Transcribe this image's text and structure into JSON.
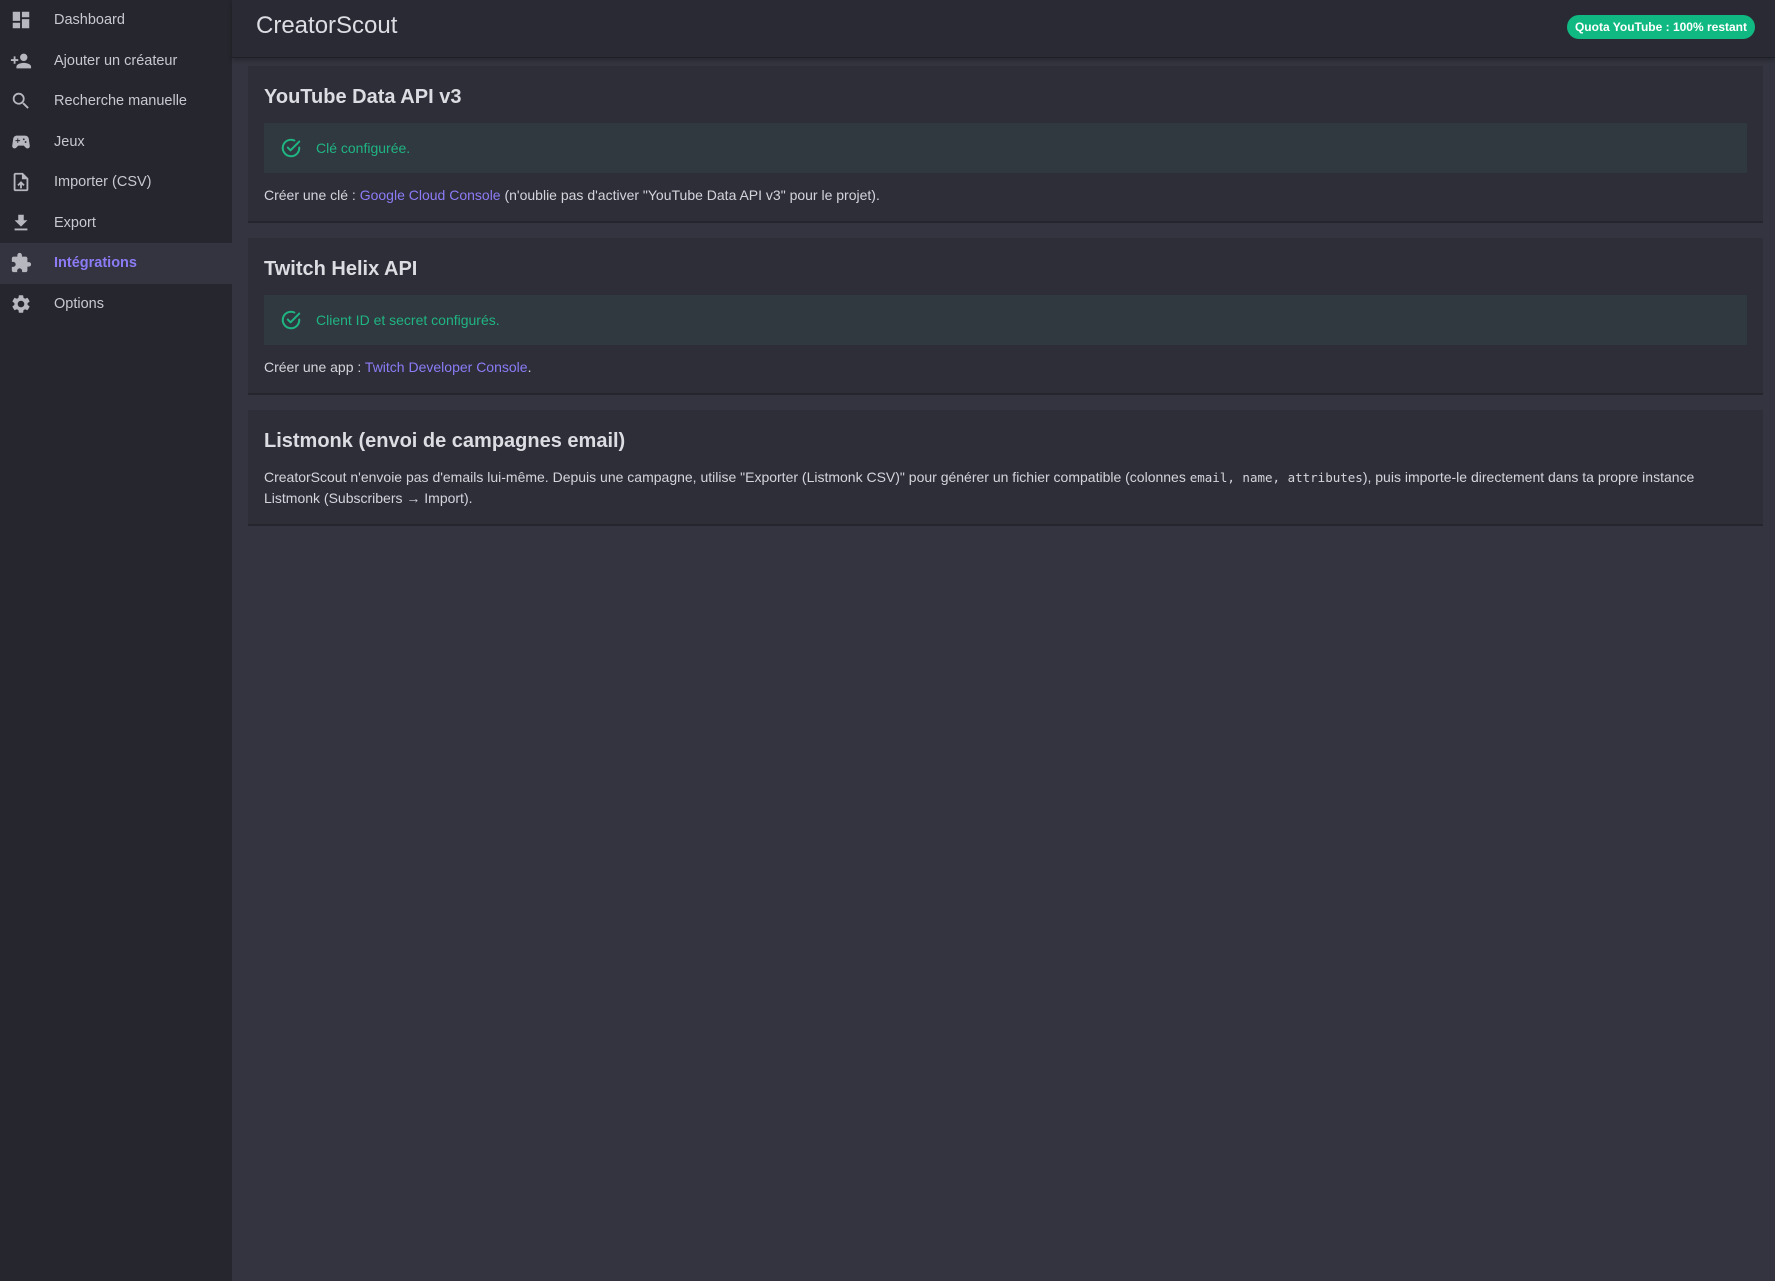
{
  "sidebar": {
    "items": [
      {
        "label": "Dashboard",
        "icon": "dashboard-icon",
        "active": false
      },
      {
        "label": "Ajouter un créateur",
        "icon": "person-add-icon",
        "active": false
      },
      {
        "label": "Recherche manuelle",
        "icon": "search-icon",
        "active": false
      },
      {
        "label": "Jeux",
        "icon": "gamepad-icon",
        "active": false
      },
      {
        "label": "Importer (CSV)",
        "icon": "file-upload-icon",
        "active": false
      },
      {
        "label": "Export",
        "icon": "download-icon",
        "active": false
      },
      {
        "label": "Intégrations",
        "icon": "puzzle-icon",
        "active": true
      },
      {
        "label": "Options",
        "icon": "gear-icon",
        "active": false
      }
    ]
  },
  "header": {
    "title": "CreatorScout",
    "quota_badge": "Quota YouTube : 100% restant"
  },
  "cards": {
    "youtube": {
      "title": "YouTube Data API v3",
      "status": "Clé configurée.",
      "text_before": "Créer une clé : ",
      "link": "Google Cloud Console",
      "text_after": " (n'oublie pas d'activer \"YouTube Data API v3\" pour le projet)."
    },
    "twitch": {
      "title": "Twitch Helix API",
      "status": "Client ID et secret configurés.",
      "text_before": "Créer une app : ",
      "link": "Twitch Developer Console",
      "text_after": "."
    },
    "listmonk": {
      "title": "Listmonk (envoi de campagnes email)",
      "text_before": "CreatorScout n'envoie pas d'emails lui-même. Depuis une campagne, utilise \"Exporter (Listmonk CSV)\" pour générer un fichier compatible (colonnes ",
      "code": "email, name, attributes",
      "text_after": "), puis importe-le directement dans ta propre instance Listmonk (Subscribers → Import)."
    }
  },
  "colors": {
    "accent": "#8b7cf6",
    "success": "#10b981",
    "sidebar_bg": "#25262e",
    "main_bg": "#33343f"
  }
}
